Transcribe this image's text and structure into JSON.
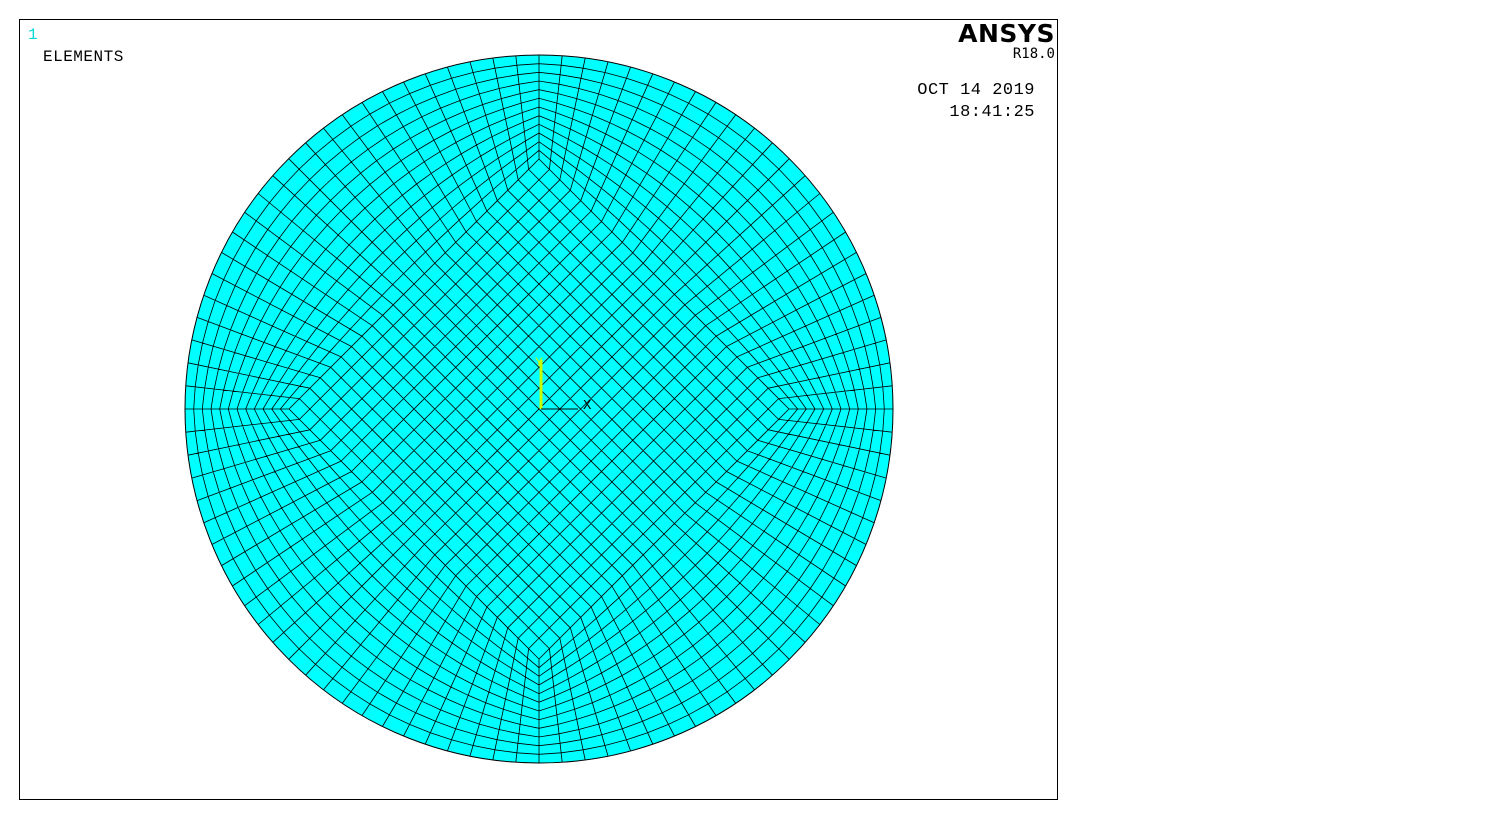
{
  "window": {
    "number": "1",
    "plot_label": "ELEMENTS"
  },
  "brand": {
    "logo": "ANSYS",
    "version": "R18.0"
  },
  "timestamp": {
    "date": "OCT 14 2019",
    "time": "18:41:25"
  },
  "triad": {
    "y_label": "Y",
    "x_label": "X"
  },
  "colors": {
    "mesh_fill": "#00ffff",
    "mesh_lines": "#000000",
    "background": "#ffffff",
    "window_number": "#00d8d8",
    "triad_y_axis": "#c8ff00"
  }
}
